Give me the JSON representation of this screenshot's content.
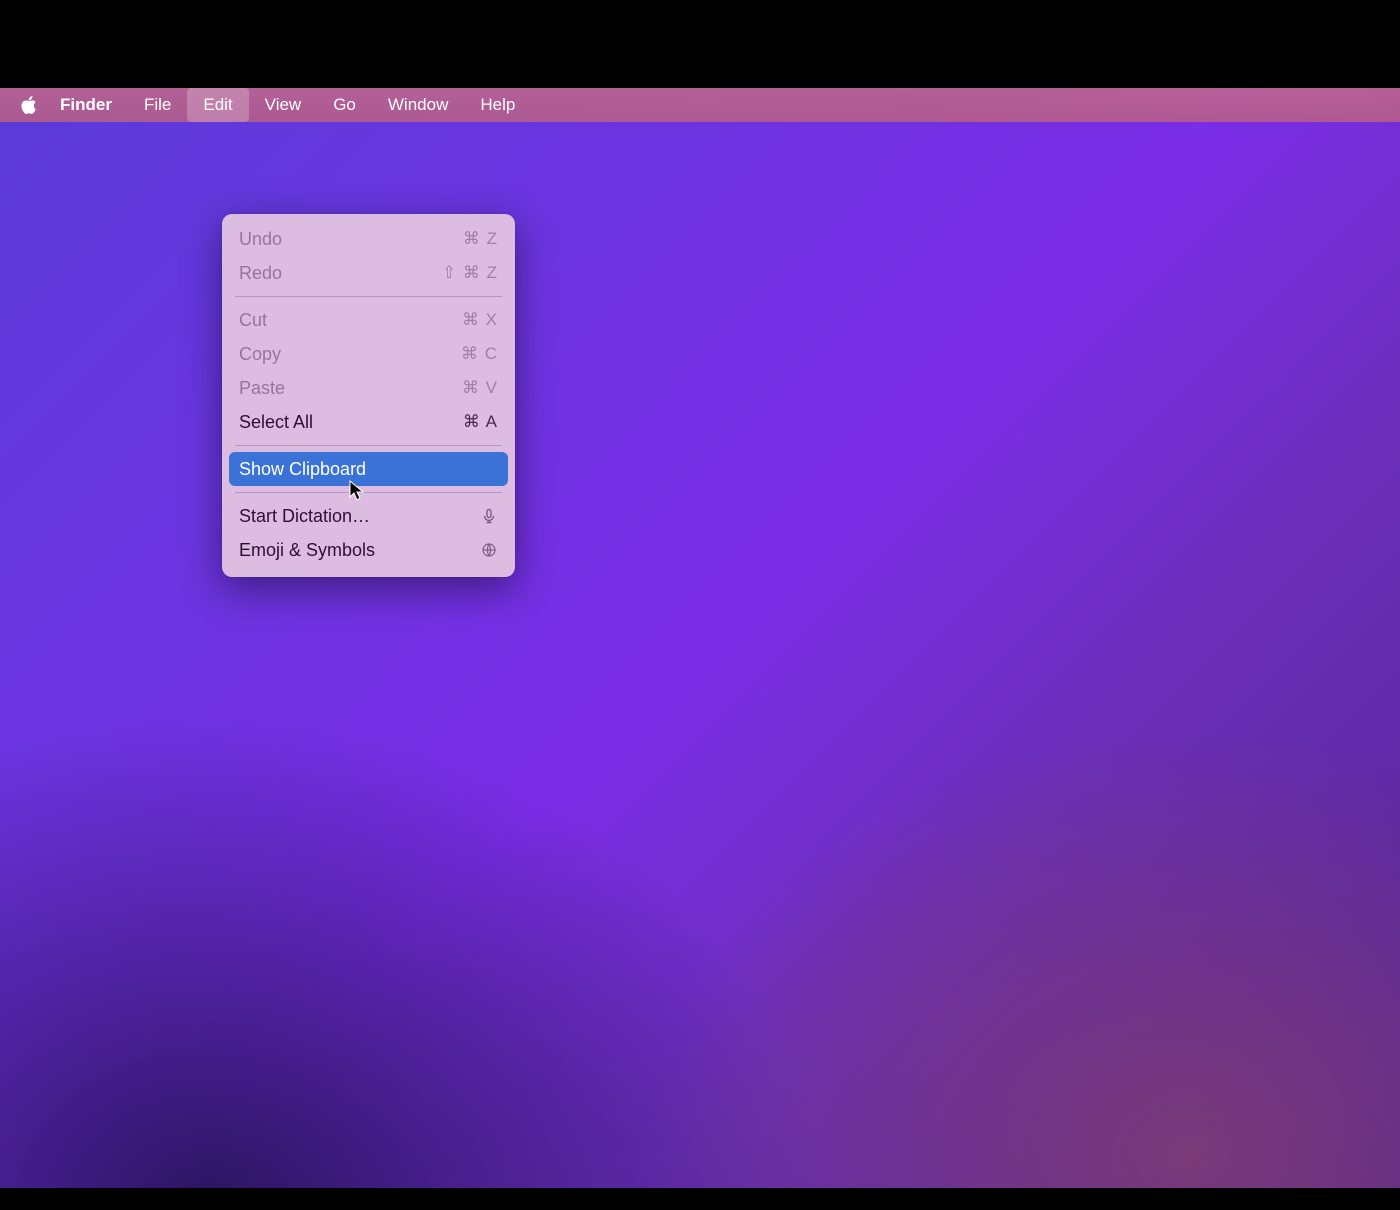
{
  "menubar": {
    "app_name": "Finder",
    "items": [
      {
        "label": "File"
      },
      {
        "label": "Edit",
        "active": true
      },
      {
        "label": "View"
      },
      {
        "label": "Go"
      },
      {
        "label": "Window"
      },
      {
        "label": "Help"
      }
    ]
  },
  "edit_menu": {
    "undo": {
      "label": "Undo",
      "shortcut": "⌘ Z"
    },
    "redo": {
      "label": "Redo",
      "shortcut": "⇧ ⌘ Z"
    },
    "cut": {
      "label": "Cut",
      "shortcut": "⌘ X"
    },
    "copy": {
      "label": "Copy",
      "shortcut": "⌘ C"
    },
    "paste": {
      "label": "Paste",
      "shortcut": "⌘ V"
    },
    "select_all": {
      "label": "Select All",
      "shortcut": "⌘ A"
    },
    "show_clip": {
      "label": "Show Clipboard"
    },
    "dictation": {
      "label": "Start Dictation…"
    },
    "emoji": {
      "label": "Emoji & Symbols"
    }
  },
  "icons": {
    "mic": "mic-icon",
    "globe": "globe-icon"
  }
}
